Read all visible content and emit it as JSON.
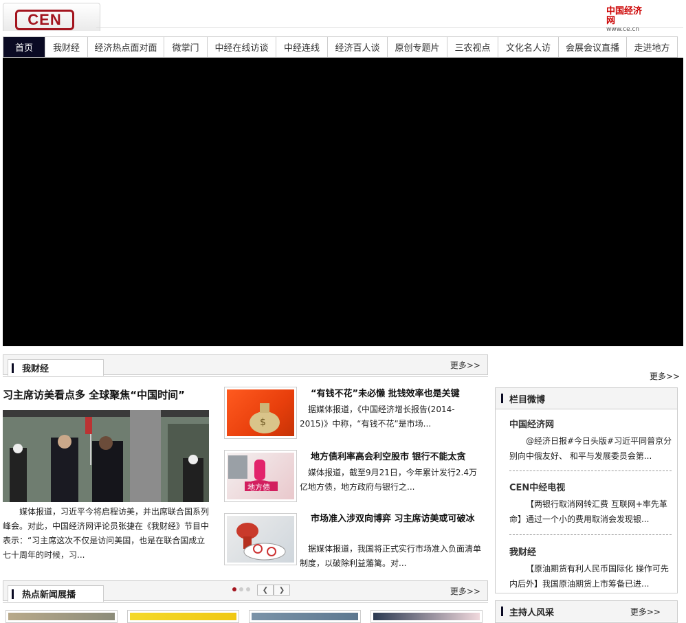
{
  "header": {
    "logo_text": "CEN",
    "ce_logo_cn": "中国经济网",
    "ce_logo_url": "www.ce.cn"
  },
  "nav": [
    "首页",
    "我财经",
    "经济热点面对面",
    "微掌门",
    "中经在线访谈",
    "中经连线",
    "经济百人谈",
    "原创专题片",
    "三农视点",
    "文化名人访",
    "会展会议直播",
    "走进地方"
  ],
  "section1": {
    "title": "我财经",
    "more": "更多>>",
    "lead": {
      "title": "习主席访美看点多 全球聚焦“中国时间”",
      "text": "媒体报道，习近平今将启程访美，并出席联合国系列峰会。对此，中国经济网评论员张捷在《我财经》节目中表示：“习主席这次不仅是访问美国，也是在联合国成立七十周年的时候，习..."
    },
    "items": [
      {
        "title": "“有钱不花”未必懒 批钱效率也是关键",
        "text": "据媒体报道，《中国经济增长报告(2014-2015)》中称，“有钱不花”是市场..."
      },
      {
        "title": "地方债利率高会利空股市 银行不能太贪",
        "text": "媒体报道，截至9月21日，今年累计发行2.4万亿地方债，地方政府与银行之..."
      },
      {
        "title": "市场准入涉双向博弈 习主席访美或可破冰",
        "text": "据媒体报道，我国将正式实行市场准入负面清单制度，以破除利益藩篱。对..."
      }
    ]
  },
  "section2": {
    "title": "热点新闻展播",
    "more": "更多>>"
  },
  "sidebar": {
    "top_more": "更多>>",
    "weibo": {
      "title": "栏目微博",
      "entries": [
        {
          "name": "中国经济网",
          "text": "@经济日报#今日头版#习近平同普京分别向中俄友好、 和平与发展委员会第..."
        },
        {
          "name": "CEN中经电视",
          "text": "【两银行取消网转汇费 互联网+率先革命】通过一个小的费用取消会发现银..."
        },
        {
          "name": "我财经",
          "text": "【原油期货有利人民币国际化 操作可先内后外】我国原油期货上市筹备已进..."
        }
      ]
    },
    "host": {
      "title": "主持人风采",
      "more": "更多>>"
    }
  },
  "colors": {
    "nav_active": "#0a0a23",
    "brand_red": "#a3141e",
    "border": "#cccccc"
  }
}
